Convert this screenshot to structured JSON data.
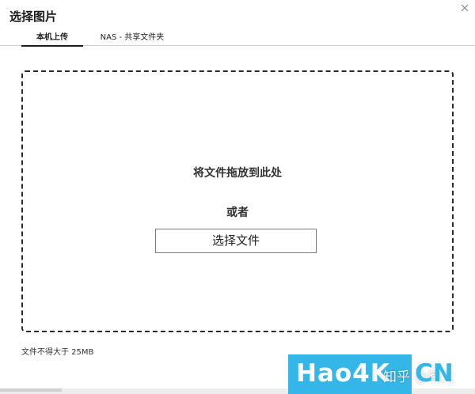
{
  "dialog": {
    "title": "选择图片",
    "close_icon": "close-icon"
  },
  "tabs": [
    {
      "label": "本机上传",
      "active": true
    },
    {
      "label": "NAS - 共享文件夹",
      "active": false
    }
  ],
  "dropzone": {
    "drop_text": "将文件拖放到此处",
    "or_text": "或者",
    "choose_button": "选择文件"
  },
  "size_note": "文件不得大于 25MB",
  "watermark": {
    "brand": "Hao4K",
    "zhihu": "知乎 @晴天",
    "suffix": "CN",
    "color": "#34b7e8"
  }
}
